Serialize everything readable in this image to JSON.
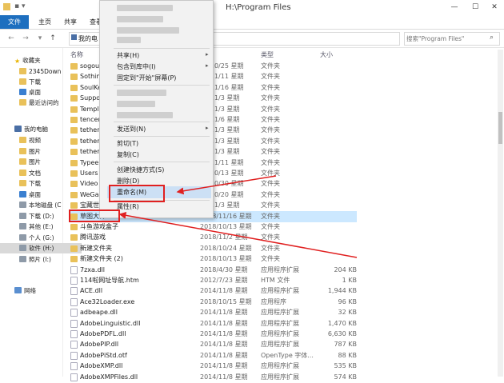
{
  "window": {
    "title": "H:\\Program Files",
    "minimize": "—",
    "maximize": "☐",
    "close": "✕"
  },
  "ribbon": {
    "file_tab": "文件",
    "tabs": [
      "主页",
      "共享",
      "查看"
    ]
  },
  "address": {
    "path": "我的电",
    "search_placeholder": "搜索\"Program Files\""
  },
  "nav": {
    "favorites": "收藏夹",
    "fav_items": [
      "2345Down",
      "下载",
      "桌面",
      "最近访问的"
    ],
    "this_pc": "我的电脑",
    "pc_items": [
      "视频",
      "图片",
      "图片",
      "文档",
      "下载",
      "桌面",
      "本地磁盘 (C",
      "下载 (D:)",
      "其他 (E:)",
      "个人 (G:)",
      "软件 (H:)",
      "照片 (I:)"
    ],
    "network": "网络"
  },
  "columns": {
    "name": "名称",
    "date": "修改日期",
    "type": "类型",
    "size": "大小"
  },
  "files": [
    {
      "name": "sogou",
      "date": "18/10/25 星期",
      "type": "文件夹",
      "size": "",
      "kind": "folder"
    },
    {
      "name": "Sothin",
      "date": "18/11/11 星期",
      "type": "文件夹",
      "size": "",
      "kind": "folder"
    },
    {
      "name": "SoulKe",
      "date": "18/11/16 星期",
      "type": "文件夹",
      "size": "",
      "kind": "folder"
    },
    {
      "name": "Suppo",
      "date": "18/11/3 星期",
      "type": "文件夹",
      "size": "",
      "kind": "folder"
    },
    {
      "name": "Templ",
      "date": "18/11/3 星期",
      "type": "文件夹",
      "size": "",
      "kind": "folder"
    },
    {
      "name": "tencen",
      "date": "18/11/6 星期",
      "type": "文件夹",
      "size": "",
      "kind": "folder"
    },
    {
      "name": "tether_",
      "date": "18/11/3 星期",
      "type": "文件夹",
      "size": "",
      "kind": "folder"
    },
    {
      "name": "tether_",
      "date": "18/11/3 星期",
      "type": "文件夹",
      "size": "",
      "kind": "folder"
    },
    {
      "name": "tether_",
      "date": "18/11/3 星期",
      "type": "文件夹",
      "size": "",
      "kind": "folder"
    },
    {
      "name": "Typee",
      "date": "18/11/11 星期",
      "type": "文件夹",
      "size": "",
      "kind": "folder"
    },
    {
      "name": "Users",
      "date": "18/10/13 星期",
      "type": "文件夹",
      "size": "",
      "kind": "folder"
    },
    {
      "name": "Video",
      "date": "18/10/30 星期",
      "type": "文件夹",
      "size": "",
      "kind": "folder"
    },
    {
      "name": "WeGa",
      "date": "18/10/20 星期",
      "type": "文件夹",
      "size": "",
      "kind": "folder"
    },
    {
      "name": "宝藏世",
      "date": "18/11/3 星期",
      "type": "文件夹",
      "size": "",
      "kind": "folder"
    },
    {
      "name": "草图大师",
      "date": "2018/11/16 星期",
      "type": "文件夹",
      "size": "",
      "kind": "folder",
      "selected": true
    },
    {
      "name": "斗鱼游戏盒子",
      "date": "2018/10/13 星期",
      "type": "文件夹",
      "size": "",
      "kind": "folder"
    },
    {
      "name": "腾讯游戏",
      "date": "2018/11/2 星期",
      "type": "文件夹",
      "size": "",
      "kind": "folder"
    },
    {
      "name": "新建文件夹",
      "date": "2018/10/24 星期",
      "type": "文件夹",
      "size": "",
      "kind": "folder"
    },
    {
      "name": "新建文件夹 (2)",
      "date": "2018/10/13 星期",
      "type": "文件夹",
      "size": "",
      "kind": "folder"
    },
    {
      "name": "7zxa.dll",
      "date": "2018/4/30 星期",
      "type": "应用程序扩展",
      "size": "204 KB",
      "kind": "file"
    },
    {
      "name": "114啦网址导航.htm",
      "date": "2012/7/23 星期",
      "type": "HTM 文件",
      "size": "1 KB",
      "kind": "file"
    },
    {
      "name": "ACE.dll",
      "date": "2014/11/8 星期",
      "type": "应用程序扩展",
      "size": "1,944 KB",
      "kind": "file"
    },
    {
      "name": "Ace32Loader.exe",
      "date": "2018/10/15 星期",
      "type": "应用程序",
      "size": "96 KB",
      "kind": "file"
    },
    {
      "name": "adbeape.dll",
      "date": "2014/11/8 星期",
      "type": "应用程序扩展",
      "size": "32 KB",
      "kind": "file"
    },
    {
      "name": "AdobeLinguistic.dll",
      "date": "2014/11/8 星期",
      "type": "应用程序扩展",
      "size": "1,470 KB",
      "kind": "file"
    },
    {
      "name": "AdobePDFL.dll",
      "date": "2014/11/8 星期",
      "type": "应用程序扩展",
      "size": "6,630 KB",
      "kind": "file"
    },
    {
      "name": "AdobePIP.dll",
      "date": "2014/11/8 星期",
      "type": "应用程序扩展",
      "size": "787 KB",
      "kind": "file"
    },
    {
      "name": "AdobePiStd.otf",
      "date": "2014/11/8 星期",
      "type": "OpenType 字体...",
      "size": "88 KB",
      "kind": "file"
    },
    {
      "name": "AdobeXMP.dll",
      "date": "2014/11/8 星期",
      "type": "应用程序扩展",
      "size": "535 KB",
      "kind": "file"
    },
    {
      "name": "AdobeXMPFiles.dll",
      "date": "2014/11/8 星期",
      "type": "应用程序扩展",
      "size": "574 KB",
      "kind": "file"
    }
  ],
  "context_menu": {
    "share": "共享(H)",
    "include_library": "包含到库中(I)",
    "pin_start": "固定到\"开始\"屏幕(P)",
    "send_to": "发送到(N)",
    "cut": "剪切(T)",
    "copy": "复制(C)",
    "create_shortcut": "创建快捷方式(S)",
    "delete": "删除(D)",
    "rename": "重命名(M)",
    "properties": "属性(R)",
    "submenu_arrow": "▸"
  },
  "colors": {
    "accent": "#1e6fbf",
    "selection": "#cce8ff",
    "annotation": "#e02020"
  }
}
